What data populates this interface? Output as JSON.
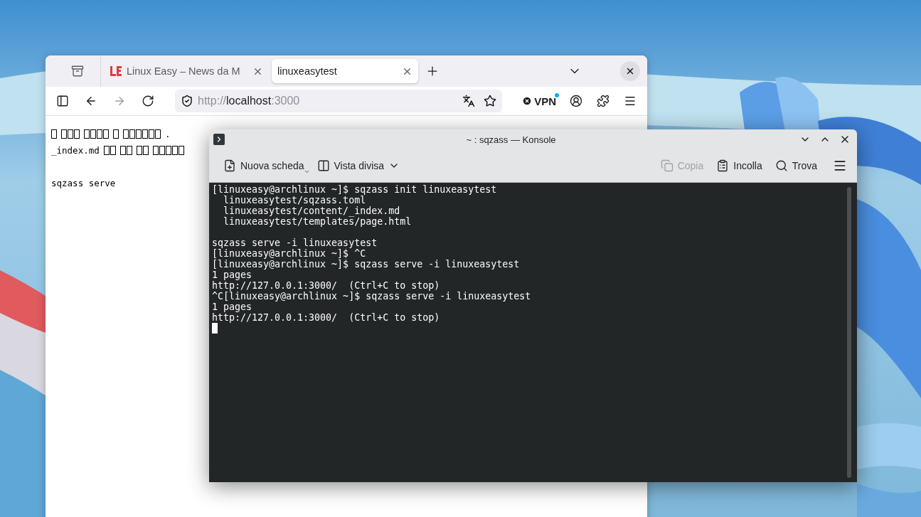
{
  "browser": {
    "tabs": [
      {
        "label": "Linux Easy – News da M",
        "kind": "site",
        "selected": false
      },
      {
        "label": "linuxeasytest",
        "kind": "plain",
        "selected": true
      }
    ],
    "url": {
      "scheme": "http://",
      "host": "localhost",
      "port": ":3000"
    },
    "vpn": {
      "label": "VPN",
      "connected": false
    },
    "content": [
      {
        "kind": "glyphs",
        "segments": [
          {
            "kind": "missing"
          },
          {
            "kind": "missing"
          },
          {
            "kind": "missing"
          },
          {
            "kind": "missing"
          },
          {
            "kind": "missing"
          },
          {
            "kind": "text",
            "text": "."
          }
        ]
      },
      {
        "kind": "glyphs",
        "segments": [
          {
            "kind": "text",
            "text": "_index.md"
          },
          {
            "kind": "missing"
          },
          {
            "kind": "missing"
          },
          {
            "kind": "missing"
          },
          {
            "kind": "missing"
          }
        ]
      },
      {
        "kind": "blank"
      },
      {
        "kind": "glyphs",
        "segments": [
          {
            "kind": "text",
            "text": "sqzass serve"
          }
        ]
      }
    ]
  },
  "konsole": {
    "title": "~ : sqzass — Konsole",
    "toolbar_left": [
      {
        "label": "Nuova scheda",
        "kind": "new-tab",
        "disabled": false
      },
      {
        "label": "Vista divisa",
        "kind": "split",
        "disabled": false
      }
    ],
    "toolbar_right": [
      {
        "label": "Copia",
        "kind": "copy",
        "disabled": true
      },
      {
        "label": "Incolla",
        "kind": "paste",
        "disabled": false
      },
      {
        "label": "Trova",
        "kind": "find",
        "disabled": false
      }
    ],
    "terminal": [
      {
        "kind": "line",
        "text": "[linuxeasy@archlinux ~]$ sqzass init linuxeasytest"
      },
      {
        "kind": "line",
        "text": "  linuxeasytest/sqzass.toml"
      },
      {
        "kind": "line",
        "text": "  linuxeasytest/content/_index.md"
      },
      {
        "kind": "line",
        "text": "  linuxeasytest/templates/page.html"
      },
      {
        "kind": "blank"
      },
      {
        "kind": "line",
        "text": "sqzass serve -i linuxeasytest"
      },
      {
        "kind": "line",
        "text": "[linuxeasy@archlinux ~]$ ^C"
      },
      {
        "kind": "line",
        "text": "[linuxeasy@archlinux ~]$ sqzass serve -i linuxeasytest"
      },
      {
        "kind": "line",
        "text": "1 pages"
      },
      {
        "kind": "line",
        "text": "http://127.0.0.1:3000/  (Ctrl+C to stop)"
      },
      {
        "kind": "line",
        "text": "^C[linuxeasy@archlinux ~]$ sqzass serve -i linuxeasytest"
      },
      {
        "kind": "line",
        "text": "1 pages"
      },
      {
        "kind": "line",
        "text": "http://127.0.0.1:3000/  (Ctrl+C to stop)"
      },
      {
        "kind": "cursor"
      }
    ]
  }
}
